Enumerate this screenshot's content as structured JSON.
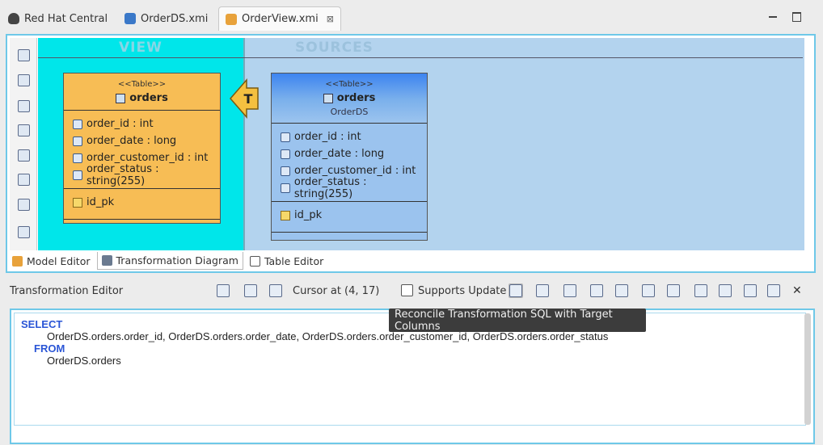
{
  "tabs": [
    {
      "label": "Red Hat Central",
      "icon": "redhat-icon"
    },
    {
      "label": "OrderDS.xmi",
      "icon": "xmi-model-icon"
    },
    {
      "label": "OrderView.xmi",
      "icon": "xmi-view-icon",
      "active": true
    }
  ],
  "diagram": {
    "view_label": "VIEW",
    "sources_label": "SOURCES",
    "transform_symbol": "T",
    "target_table": {
      "stereotype": "<<Table>>",
      "name": "orders",
      "columns": [
        "order_id : int",
        "order_date : long",
        "order_customer_id : int",
        "order_status : string(255)"
      ],
      "key": "id_pk"
    },
    "source_table": {
      "stereotype": "<<Table>>",
      "name": "orders",
      "model": "OrderDS",
      "columns": [
        "order_id : int",
        "order_date : long",
        "order_customer_id : int",
        "order_status : string(255)"
      ],
      "key": "id_pk"
    }
  },
  "view_tabs": [
    {
      "label": "Model Editor"
    },
    {
      "label": "Transformation Diagram",
      "active": true
    },
    {
      "label": "Table Editor"
    }
  ],
  "transformation_editor": {
    "title": "Transformation Editor",
    "cursor": "Cursor at (4, 17)",
    "supports_update_label": "Supports Update",
    "supports_update_checked": false,
    "sql": {
      "select_kw": "SELECT",
      "select_cols": "OrderDS.orders.order_id, OrderDS.orders.order_date, OrderDS.orders.order_customer_id, OrderDS.orders.order_status",
      "from_kw": "FROM",
      "from_table": "OrderDS.orders"
    },
    "tooltip": "Reconcile Transformation SQL with Target Columns"
  },
  "colors": {
    "view_bg": "#00e6ea",
    "sources_bg": "#b3d3ee",
    "target_table": "#f7bd55",
    "source_table": "#7ab0ec",
    "keyword": "#2a55d6",
    "focus_border": "#6ec8e8"
  }
}
